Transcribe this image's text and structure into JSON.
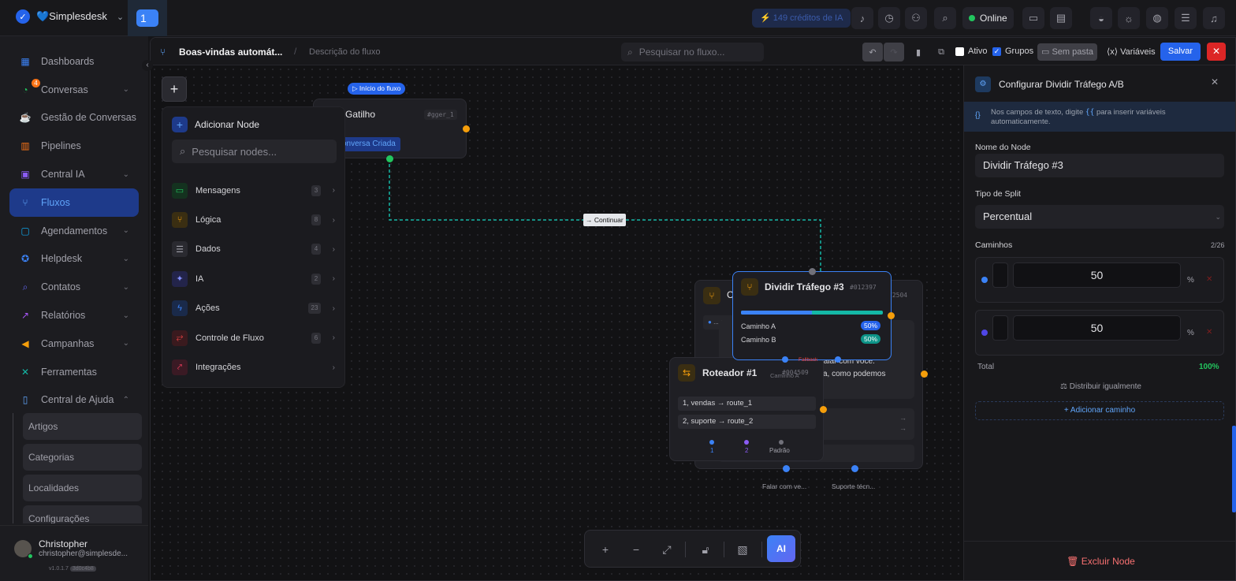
{
  "topbar": {
    "workspace": "💙Simplesdesk",
    "tab_number": "1",
    "ai_credits": "⚡ 149 créditos de IA",
    "status": "Online"
  },
  "sidebar": {
    "items": [
      {
        "label": "Dashboards",
        "icon": "dashboard-icon"
      },
      {
        "label": "Conversas",
        "icon": "chat-icon",
        "badge": "4"
      },
      {
        "label": "Gestão de Conversas",
        "icon": "coffee-icon"
      },
      {
        "label": "Pipelines",
        "icon": "kanban-icon"
      },
      {
        "label": "Central IA",
        "icon": "ai-icon"
      },
      {
        "label": "Fluxos",
        "icon": "flow-icon"
      },
      {
        "label": "Agendamentos",
        "icon": "calendar-icon"
      },
      {
        "label": "Helpdesk",
        "icon": "help-icon"
      },
      {
        "label": "Contatos",
        "icon": "contacts-icon"
      },
      {
        "label": "Relatórios",
        "icon": "chart-icon"
      },
      {
        "label": "Campanhas",
        "icon": "megaphone-icon"
      },
      {
        "label": "Ferramentas",
        "icon": "tools-icon"
      },
      {
        "label": "Central de Ajuda",
        "icon": "book-icon"
      }
    ],
    "sub_items": [
      "Artigos",
      "Categorias",
      "Localidades",
      "Configurações"
    ],
    "user": {
      "name": "Christopher",
      "email": "christopher@simplesde...",
      "version": "v1.0.1.7",
      "build": "3d0c4b8"
    }
  },
  "editor": {
    "flow_title": "Boas-vindas automát...",
    "separator": "/",
    "flow_description": "Descrição do fluxo",
    "search_placeholder": "Pesquisar no fluxo...",
    "active_label": "Ativo",
    "groups_label": "Grupos",
    "folder_label": "Sem pasta",
    "variables_label": "Variáveis",
    "save_label": "Salvar"
  },
  "add_panel": {
    "title": "Adicionar Node",
    "search_placeholder": "Pesquisar nodes...",
    "categories": [
      {
        "label": "Mensagens",
        "count": "3",
        "color": "#16a34a"
      },
      {
        "label": "Lógica",
        "count": "8",
        "color": "#f59e0b"
      },
      {
        "label": "Dados",
        "count": "4",
        "color": "#a1a1aa"
      },
      {
        "label": "IA",
        "count": "2",
        "color": "#6366f1"
      },
      {
        "label": "Ações",
        "count": "23",
        "color": "#3b82f6"
      },
      {
        "label": "Controle de Fluxo",
        "count": "6",
        "color": "#ef4444"
      },
      {
        "label": "Integrações",
        "count": "",
        "color": "#f43f5e"
      }
    ]
  },
  "canvas": {
    "start_label": "▷ Início do fluxo",
    "trigger_node": {
      "title": "Gatilho",
      "id": "#gger_1",
      "event": "onversa Criada"
    },
    "edge_label": "→ Continuar",
    "back_node": {
      "title": "C",
      "id": "72504",
      "chip": "... eq",
      "text1": "falar com você.",
      "text2": "a, como podemos",
      "out1": "Falar com ve...",
      "out2": "Suporte técn..."
    },
    "split_node": {
      "title": "Dividir Tráfego #3",
      "id": "#012397",
      "path_a_label": "Caminho A",
      "path_a_pct": "50%",
      "path_b_label": "Caminho B",
      "path_b_pct": "50%",
      "split_a": 50,
      "fallback": "Fallback",
      "out_label": "Caminho A"
    },
    "router_node": {
      "title": "Roteador #1",
      "id": "#004509",
      "route1": "1, vendas → route_1",
      "route2": "2, suporte → route_2",
      "out1": "1",
      "out2": "2",
      "out3": "Padrão"
    }
  },
  "config_panel": {
    "title": "Configurar Dividir Tráfego A/B",
    "hint_pre": "Nos campos de texto, digite",
    "hint_code": "{{",
    "hint_post": "para inserir variáveis automaticamente.",
    "node_name_label": "Nome do Node",
    "node_name_value": "Dividir Tráfego #3",
    "split_type_label": "Tipo de Split",
    "split_type_value": "Percentual",
    "paths_label": "Caminhos",
    "paths_count": "2/26",
    "paths": [
      {
        "value": "50",
        "color": "#3b82f6"
      },
      {
        "value": "50",
        "color": "#4f46e5"
      }
    ],
    "percent_sign": "%",
    "total_label": "Total",
    "total_value": "100%",
    "distribute_label": "⚖ Distribuir igualmente",
    "add_path_label": "+ Adicionar caminho",
    "delete_label": "Excluir Node"
  },
  "colors": {
    "accent": "#2563eb",
    "success": "#22c55e",
    "danger": "#dc2626",
    "port": "#f59e0b"
  }
}
